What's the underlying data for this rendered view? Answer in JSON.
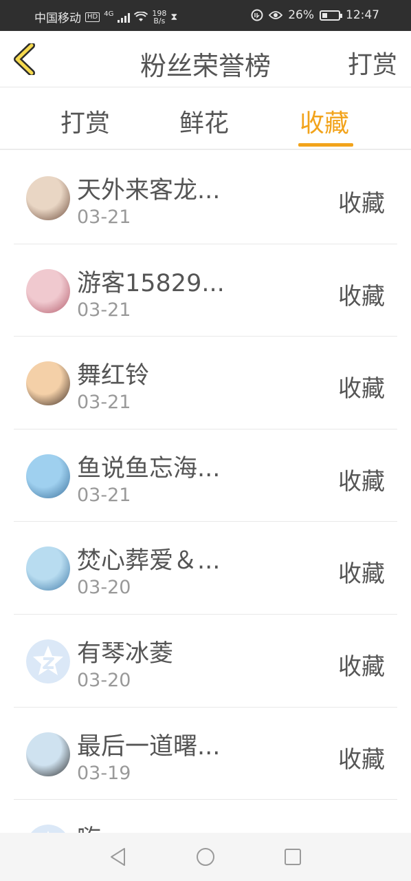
{
  "status_bar": {
    "carrier": "中国移动",
    "hd": "HD",
    "network": "4G",
    "speed_value": "198",
    "speed_unit": "B/s",
    "battery_percent": "26%",
    "battery_level": 0.26,
    "time": "12:47"
  },
  "header": {
    "title": "粉丝荣誉榜",
    "action_label": "打赏"
  },
  "tabs": [
    {
      "label": "打赏",
      "active": false
    },
    {
      "label": "鲜花",
      "active": false
    },
    {
      "label": "收藏",
      "active": true
    }
  ],
  "list": [
    {
      "name": "天外来客龙...",
      "date": "03-21",
      "type": "收藏",
      "avatar": "anime-boy-avatar",
      "colors": [
        "#e9d6c4",
        "#6b4a3a"
      ]
    },
    {
      "name": "游客15829...",
      "date": "03-21",
      "type": "收藏",
      "avatar": "girl-pink-avatar",
      "colors": [
        "#f0c9cf",
        "#b25a6a"
      ]
    },
    {
      "name": "舞红铃",
      "date": "03-21",
      "type": "收藏",
      "avatar": "anime-girls-avatar",
      "colors": [
        "#f4d0a8",
        "#3a2a22"
      ]
    },
    {
      "name": "鱼说鱼忘海...",
      "date": "03-21",
      "type": "收藏",
      "avatar": "ocean-avatar",
      "colors": [
        "#9fd0ef",
        "#3a6f9a"
      ]
    },
    {
      "name": "焚心葬爱＆...",
      "date": "03-20",
      "type": "收藏",
      "avatar": "blue-art-avatar",
      "colors": [
        "#b8dcf0",
        "#3f7aa8"
      ]
    },
    {
      "name": "有琴冰菱",
      "date": "03-20",
      "type": "收藏",
      "avatar": "default-star-avatar",
      "colors": [
        "#dbe8f7",
        "#ffffff"
      ]
    },
    {
      "name": "最后一道曙...",
      "date": "03-19",
      "type": "收藏",
      "avatar": "woman-photo-avatar",
      "colors": [
        "#cfe2f0",
        "#2a2a2a"
      ]
    },
    {
      "name": "嗨",
      "date": "",
      "type": "",
      "avatar": "default-star-avatar",
      "colors": [
        "#dbe8f7",
        "#ffffff"
      ]
    }
  ],
  "colors": {
    "accent": "#f2a31b",
    "back_icon_fill": "#f5d94e"
  }
}
